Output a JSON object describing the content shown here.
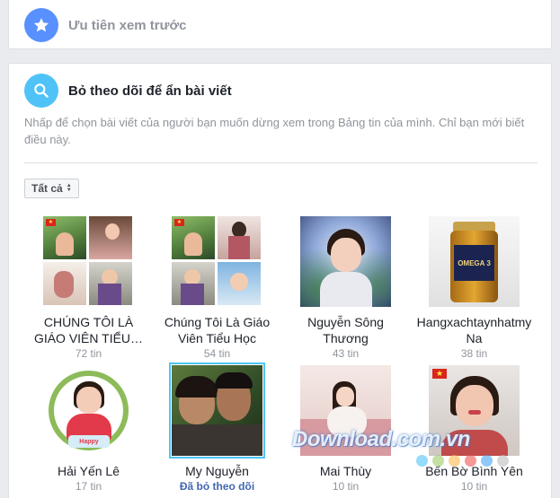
{
  "priority": {
    "title": "Ưu tiên xem trước",
    "icon": "star-icon"
  },
  "unfollow": {
    "title": "Bỏ theo dõi để ẩn bài viết",
    "icon": "search-icon",
    "description": "Nhấp để chọn bài viết của người bạn muốn dừng xem trong Bảng tin của mình. Chỉ bạn mới biết điều này.",
    "filter_label": "Tất cả"
  },
  "tiles": [
    {
      "name": "CHÚNG TÔI LÀ GIÁO VIÊN TIỂU…",
      "count": "72 tin"
    },
    {
      "name": "Chúng Tôi Là Giáo Viên Tiểu Học",
      "count": "54 tin"
    },
    {
      "name": "Nguyễn Sông Thương",
      "count": "43 tin"
    },
    {
      "name": "Hangxachtaynhatmy Na",
      "count": "38 tin",
      "product_label": "OMEGA 3"
    },
    {
      "name": "Hải Yến Lê",
      "count": "17 tin",
      "badge": "Happy"
    },
    {
      "name": "My Nguyễn",
      "count": "Đã bỏ theo dõi",
      "state": "unfollowed"
    },
    {
      "name": "Mai Thùy",
      "count": "10 tin"
    },
    {
      "name": "Bến Bờ Bình Yên",
      "count": "10 tin"
    }
  ],
  "watermark": "Download.com.vn",
  "colors": {
    "accent": "#4267b2",
    "selected": "#4fc3f7",
    "priority_icon_bg": "#5890ff",
    "unfollow_icon_bg": "#4fc3f7"
  }
}
